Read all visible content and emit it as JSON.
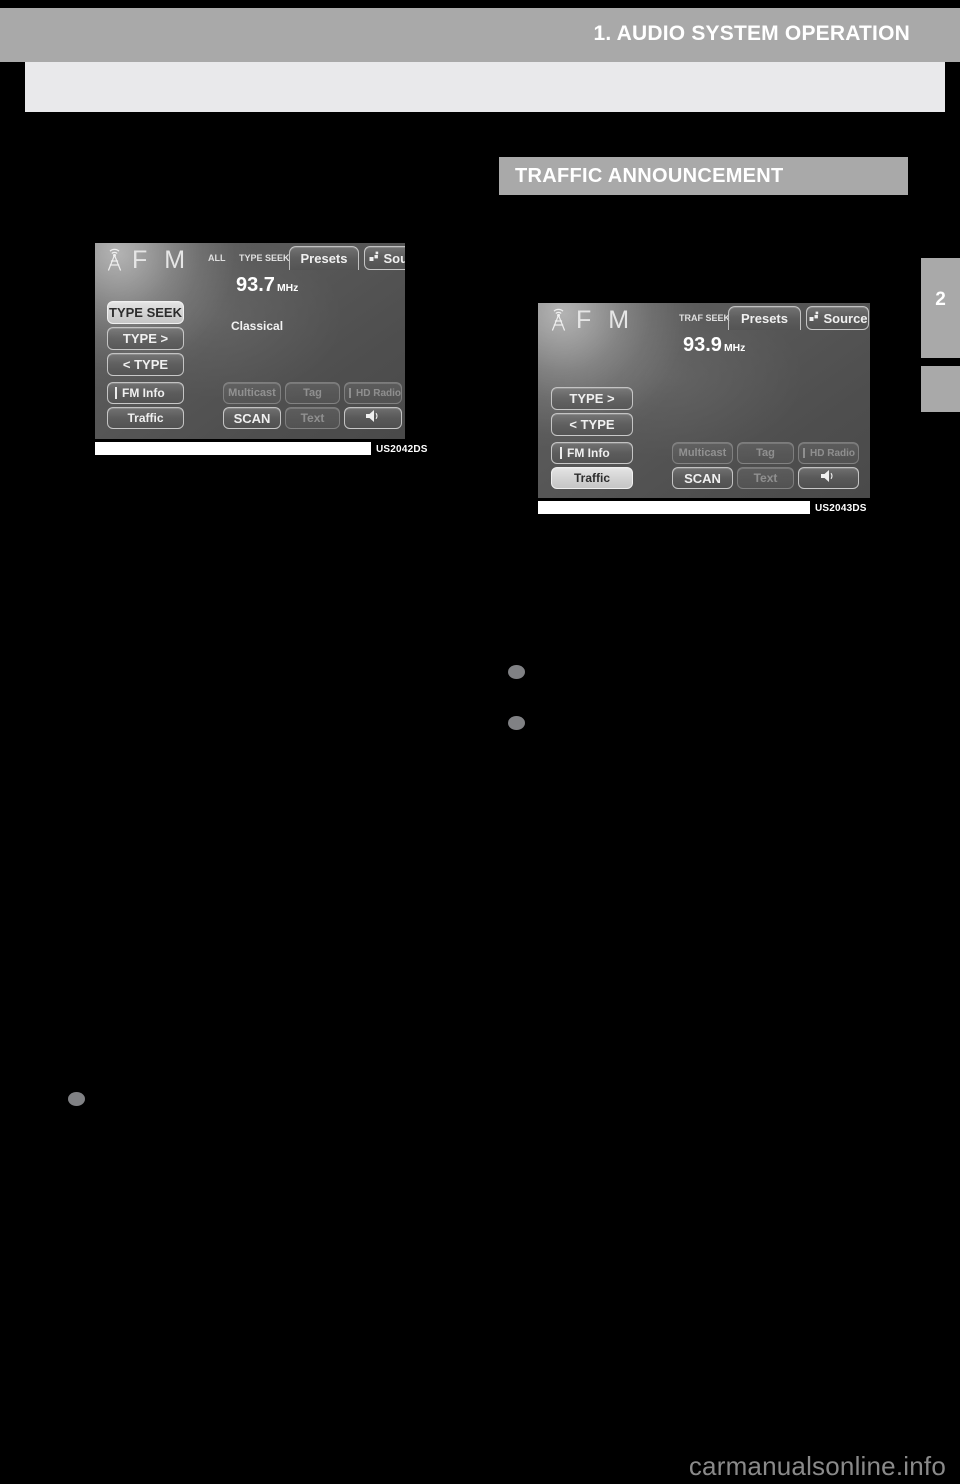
{
  "page": {
    "header_title": "1. AUDIO SYSTEM OPERATION",
    "chapter_tab": "2",
    "watermark": "carmanualsonline.info"
  },
  "section": {
    "heading": "TRAFFIC ANNOUNCEMENT"
  },
  "figures": [
    {
      "id": "left-figure",
      "code": "US2042DS",
      "screen": {
        "band_logo": "F M",
        "tower_icon": "radio-tower-icon",
        "status_mode": "ALL",
        "seek_label": "TYPE SEEK",
        "presets_tab": "Presets",
        "source_tab": "Source",
        "source_icon": "source-grid-icon",
        "frequency": "93.7",
        "frequency_unit": "MHz",
        "genre": "Classical",
        "left_buttons": [
          {
            "label": "TYPE SEEK",
            "state": "highlighted",
            "indicator": false
          },
          {
            "label": "TYPE >",
            "state": "normal",
            "indicator": false
          },
          {
            "label": "< TYPE",
            "state": "normal",
            "indicator": false
          },
          {
            "label": "FM Info",
            "state": "normal",
            "indicator": true
          },
          {
            "label": "Traffic",
            "state": "normal",
            "indicator": false
          }
        ],
        "bottom_buttons": [
          {
            "label": "Multicast",
            "state": "disabled",
            "indicator": false
          },
          {
            "label": "Tag",
            "state": "disabled",
            "indicator": false
          },
          {
            "label": "HD Radio",
            "state": "disabled",
            "indicator": true
          },
          {
            "label": "SCAN",
            "state": "normal",
            "indicator": false
          },
          {
            "label": "Text",
            "state": "disabled",
            "indicator": false
          },
          {
            "label": "speaker-icon",
            "state": "normal",
            "indicator": false
          }
        ]
      }
    },
    {
      "id": "right-figure",
      "code": "US2043DS",
      "screen": {
        "band_logo": "F M",
        "tower_icon": "radio-tower-icon",
        "status_mode": "",
        "seek_label": "TRAF SEEK",
        "presets_tab": "Presets",
        "source_tab": "Source",
        "source_icon": "source-grid-icon",
        "frequency": "93.9",
        "frequency_unit": "MHz",
        "genre": "",
        "left_buttons": [
          {
            "label": "TYPE >",
            "state": "normal",
            "indicator": false
          },
          {
            "label": "< TYPE",
            "state": "normal",
            "indicator": false
          },
          {
            "label": "FM Info",
            "state": "normal",
            "indicator": true
          },
          {
            "label": "Traffic",
            "state": "highlighted",
            "indicator": false
          }
        ],
        "bottom_buttons": [
          {
            "label": "Multicast",
            "state": "disabled",
            "indicator": false
          },
          {
            "label": "Tag",
            "state": "disabled",
            "indicator": false
          },
          {
            "label": "HD Radio",
            "state": "disabled",
            "indicator": true
          },
          {
            "label": "SCAN",
            "state": "normal",
            "indicator": false
          },
          {
            "label": "Text",
            "state": "disabled",
            "indicator": false
          },
          {
            "label": "speaker-icon",
            "state": "normal",
            "indicator": false
          }
        ]
      }
    }
  ],
  "bullets": [
    {
      "name": "bullet-left-1"
    },
    {
      "name": "bullet-right-1"
    },
    {
      "name": "bullet-right-2"
    }
  ],
  "colors": {
    "header_gray": "#a9a9a9",
    "subband_gray": "#e9e9eb",
    "page_black": "#000000",
    "bullet_gray": "#808184",
    "watermark_gray": "#8a8a8a"
  }
}
